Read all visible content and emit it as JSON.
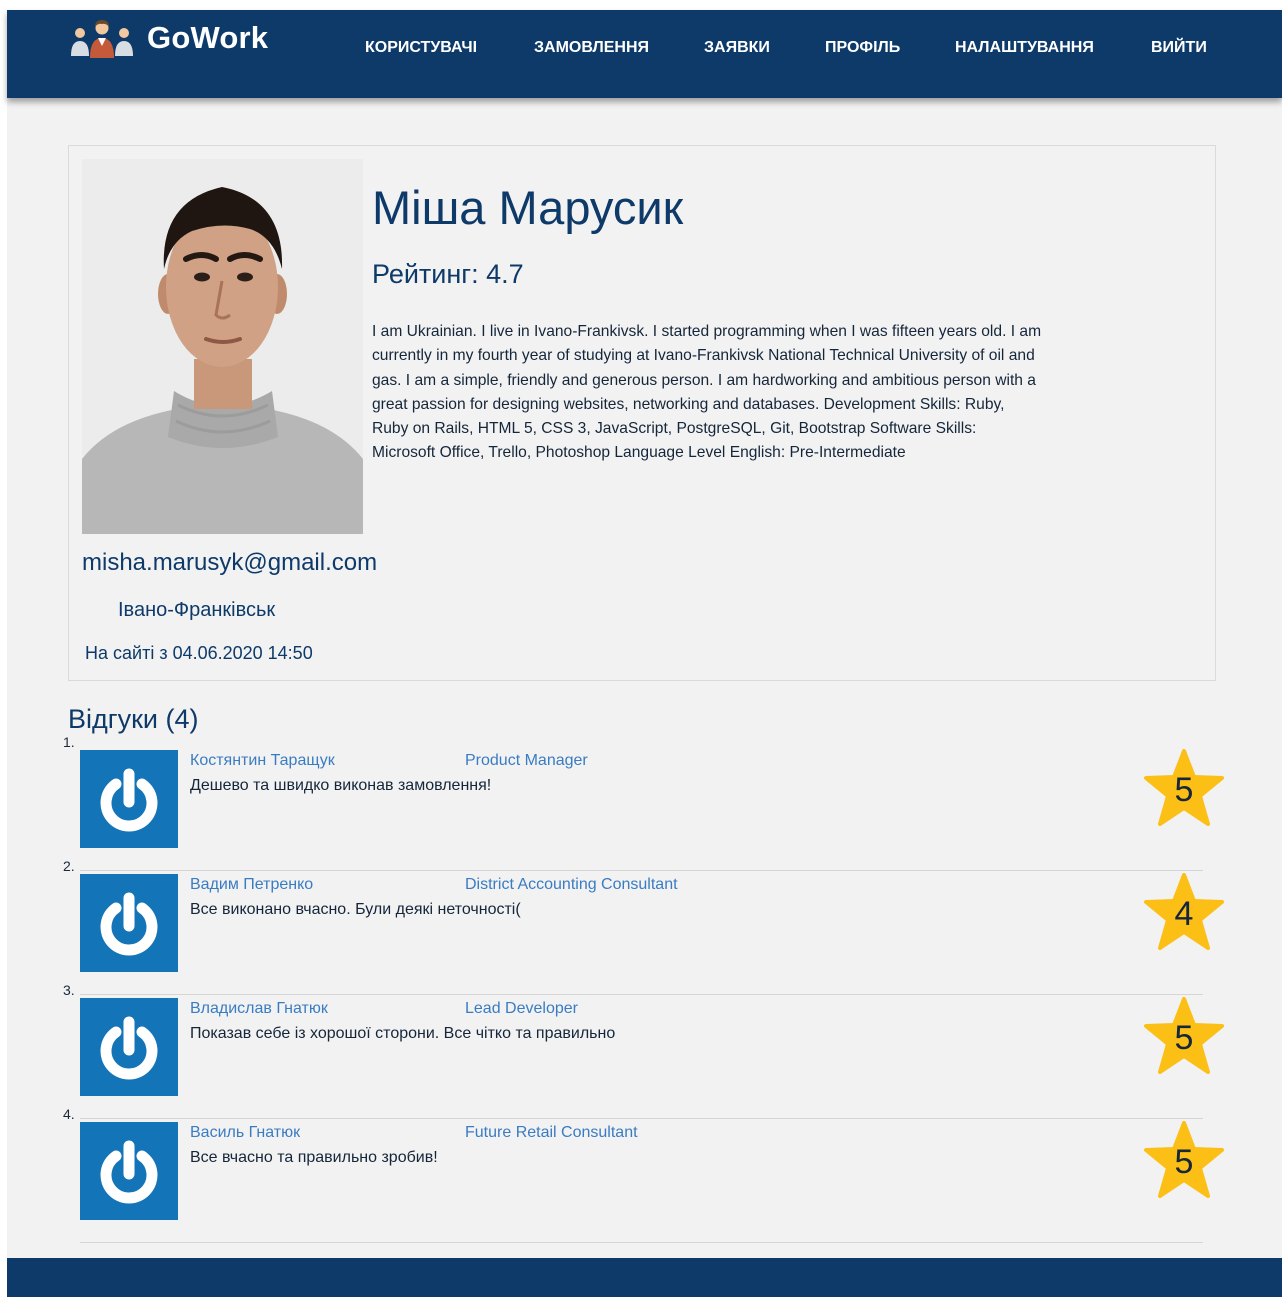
{
  "brand": {
    "name": "GoWork",
    "logo": "people-group-icon"
  },
  "nav": [
    {
      "label": "КОРИСТУВАЧІ"
    },
    {
      "label": "ЗАМОВЛЕННЯ"
    },
    {
      "label": "ЗАЯВКИ"
    },
    {
      "label": "ПРОФІЛЬ"
    },
    {
      "label": "НАЛАШТУВАННЯ"
    },
    {
      "label": "ВИЙТИ"
    }
  ],
  "profile": {
    "name": "Міша Марусик",
    "rating": "Рейтинг: 4.7",
    "bio": "I am Ukrainian. I live in Ivano-Frankivsk. I started programming when I was fifteen years old. I am currently in my fourth year of studying at Ivano-Frankivsk National Technical University of oil and gas. I am a simple, friendly and generous person. I am hardworking and ambitious person with a great passion for designing websites, networking and databases. Development Skills: Ruby, Ruby on Rails, HTML 5, CSS 3, JavaScript, PostgreSQL, Git, Bootstrap Software Skills: Microsoft Office, Trello, Photoshop Language Level English: Pre-Intermediate",
    "email": "misha.marusyk@gmail.com",
    "city": "Івано-Франківськ",
    "joined": "На сайті з 04.06.2020 14:50"
  },
  "reviews": {
    "heading": "Відгуки (4)",
    "items": [
      {
        "num": "1.",
        "author": "Костянтин Таращук",
        "role": "Product Manager",
        "text": "Дешево та швидко виконав замовлення!",
        "score": "5"
      },
      {
        "num": "2.",
        "author": "Вадим Петренко",
        "role": "District Accounting Consultant",
        "text": "Все виконано вчасно. Були деякі неточності(",
        "score": "4"
      },
      {
        "num": "3.",
        "author": "Владислав Гнатюк",
        "role": "Lead Developer",
        "text": "Показав себе із хорошої сторони. Все чітко та правильно",
        "score": "5"
      },
      {
        "num": "4.",
        "author": "Василь Гнатюк",
        "role": "Future Retail Consultant",
        "text": "Все вчасно та правильно зробив!",
        "score": "5"
      }
    ]
  },
  "colors": {
    "header": "#0e3a6a",
    "page_bg": "#f2f2f2",
    "accent_text": "#0e3a6a",
    "link": "#3a7cc2",
    "avatar_bg": "#1474b8",
    "star": "#fbbf16"
  }
}
